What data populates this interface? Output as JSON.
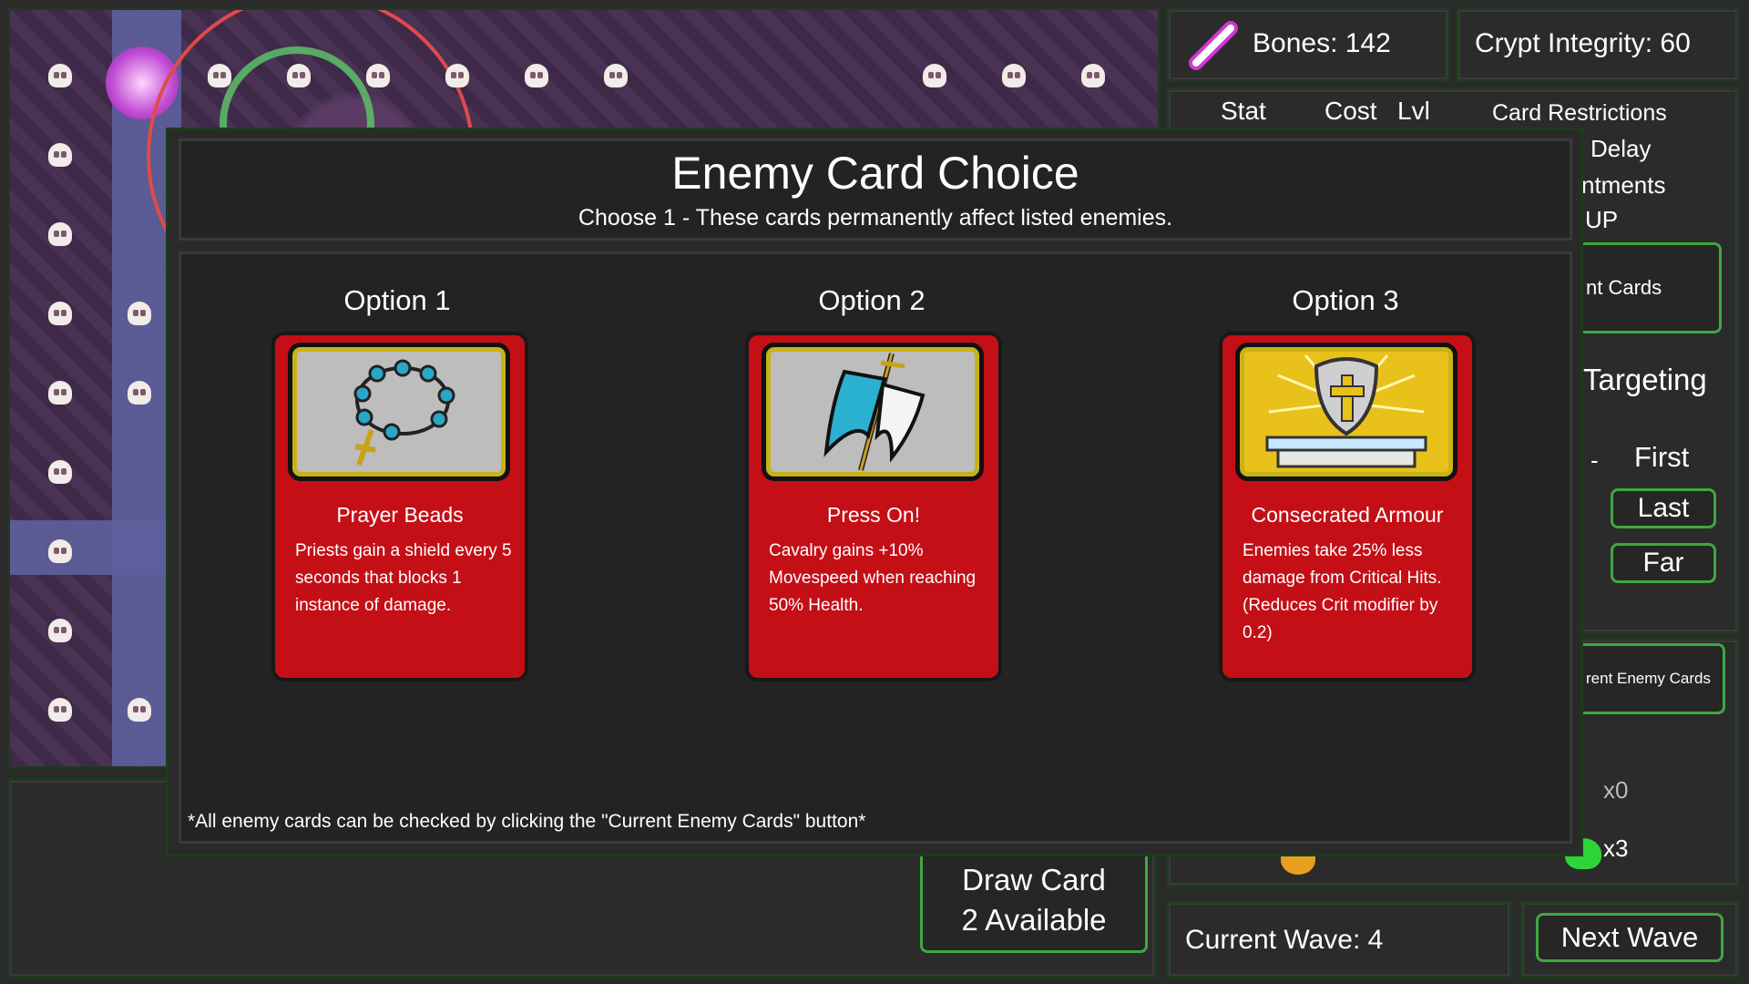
{
  "hud": {
    "bones": "Bones: 142",
    "crypt": "Crypt Integrity: 60",
    "stat_header": "Stat",
    "cost_header": "Cost",
    "lvl_header": "Lvl",
    "card_restrictions": "Card Restrictions",
    "delay": "Delay",
    "ntments": "ntments",
    "up": "UP",
    "nt_cards": "nt Cards",
    "targeting": "Targeting",
    "dash": "-",
    "first": "First",
    "last": "Last",
    "far": "Far",
    "current_enemy_cards": "rent Enemy Cards",
    "count_x0": "x0",
    "count_x3": "x3",
    "draw_card": "Draw Card",
    "draw_available": "2  Available",
    "current_wave": "Current Wave: 4",
    "next_wave": "Next Wave"
  },
  "modal": {
    "title": "Enemy Card Choice",
    "subtitle": "Choose 1 - These cards permanently affect listed enemies.",
    "footnote": "*All enemy cards can be checked by clicking the \"Current Enemy Cards\" button*",
    "options": [
      {
        "label": "Option 1",
        "name": "Prayer Beads",
        "desc": "Priests gain a shield every 5 seconds that blocks 1 instance of damage.",
        "icon": "prayer-beads-icon"
      },
      {
        "label": "Option 2",
        "name": "Press On!",
        "desc": "Cavalry gains +10% Movespeed when reaching 50% Health.",
        "icon": "banner-icon"
      },
      {
        "label": "Option 3",
        "name": "Consecrated Armour",
        "desc": "Enemies take 25% less damage from Critical Hits. (Reduces Crit modifier by 0.2)",
        "icon": "holy-shield-icon"
      }
    ]
  },
  "colors": {
    "card_red": "#c40f17",
    "accent_green": "#3fa83f",
    "bones_purple": "#d236d2"
  }
}
